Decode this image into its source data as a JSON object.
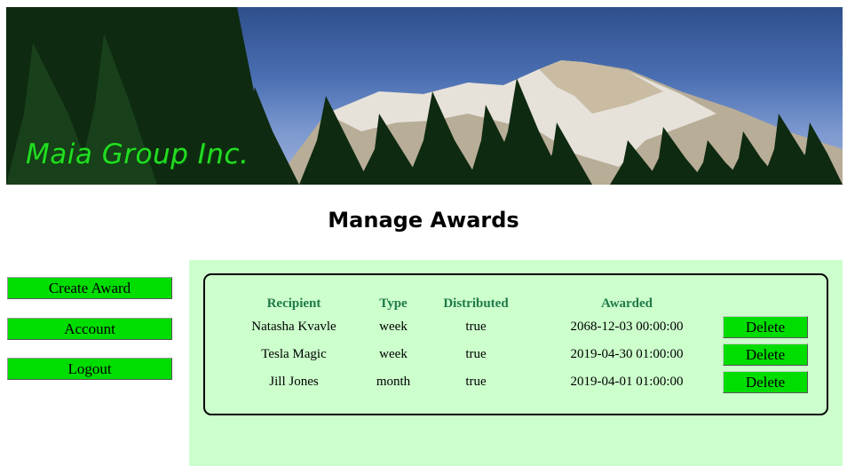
{
  "banner": {
    "logo_text": "Maia Group Inc."
  },
  "page": {
    "title": "Manage Awards"
  },
  "sidebar": {
    "items": [
      {
        "label": "Create Award"
      },
      {
        "label": "Account"
      },
      {
        "label": "Logout"
      }
    ]
  },
  "awards": {
    "headers": {
      "recipient": "Recipient",
      "type": "Type",
      "distributed": "Distributed",
      "awarded": "Awarded"
    },
    "rows": [
      {
        "recipient": "Natasha Kvavle",
        "type": "week",
        "distributed": "true",
        "awarded": "2068-12-03 00:00:00",
        "action": "Delete"
      },
      {
        "recipient": "Tesla Magic",
        "type": "week",
        "distributed": "true",
        "awarded": "2019-04-30 01:00:00",
        "action": "Delete"
      },
      {
        "recipient": "Jill Jones",
        "type": "month",
        "distributed": "true",
        "awarded": "2019-04-01 01:00:00",
        "action": "Delete"
      }
    ]
  },
  "colors": {
    "button_green": "#00dd00",
    "panel_bg": "#ccffcc",
    "header_text": "#1f7a4a",
    "logo_green": "#22dd22"
  }
}
